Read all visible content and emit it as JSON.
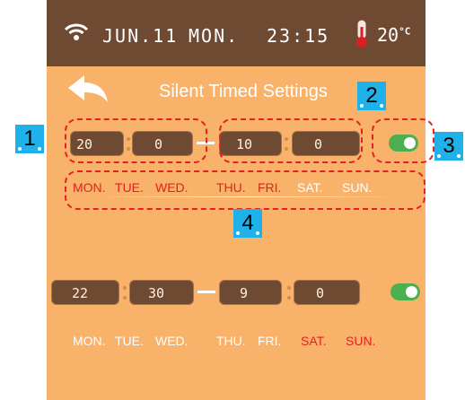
{
  "status_bar": {
    "date": "JUN.11",
    "weekday": "MON.",
    "time": "23:15",
    "temperature": "20",
    "temperature_unit": "°C",
    "icons": [
      "wifi-icon",
      "thermometer-icon"
    ]
  },
  "header": {
    "title": "Silent Timed Settings",
    "back_icon": "back-arrow-icon"
  },
  "schedules": [
    {
      "start_hour": "20",
      "start_minute": "0",
      "end_hour": "10",
      "end_minute": "0",
      "enabled": true,
      "days": [
        "MON.",
        "TUE.",
        "WED.",
        "THU.",
        "FRI.",
        "SAT.",
        "SUN."
      ],
      "active_days": [
        "MON.",
        "TUE.",
        "WED.",
        "THU.",
        "FRI."
      ]
    },
    {
      "start_hour": "22",
      "start_minute": "30",
      "end_hour": "9",
      "end_minute": "0",
      "enabled": true,
      "days": [
        "MON.",
        "TUE.",
        "WED.",
        "THU.",
        "FRI.",
        "SAT.",
        "SUN."
      ],
      "active_days": [
        "SAT.",
        "SUN."
      ]
    }
  ],
  "annotations": [
    "1",
    "2",
    "3",
    "4"
  ],
  "colors": {
    "screen_bg": "#f9b26a",
    "status_bar_bg": "#6f4a33",
    "day_active": "#e52020",
    "day_inactive": "#ffffff",
    "toggle_on": "#4caf50",
    "annotation_box": "#e52020",
    "annotation_marker": "#1fb2ea"
  }
}
